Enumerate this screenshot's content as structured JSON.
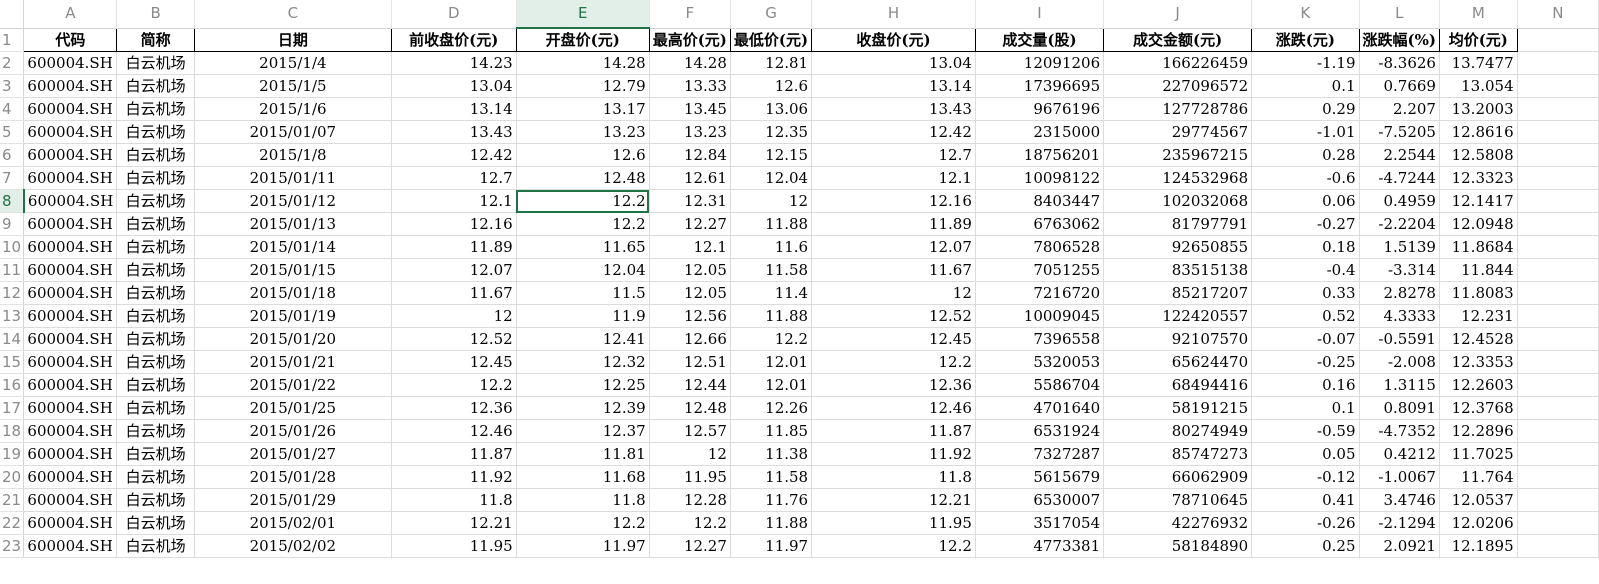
{
  "columns": [
    "A",
    "B",
    "C",
    "D",
    "E",
    "F",
    "G",
    "H",
    "I",
    "J",
    "K",
    "L",
    "M",
    "N"
  ],
  "headers": [
    "代码",
    "简称",
    "日期",
    "前收盘价(元)",
    "开盘价(元)",
    "最高价(元)",
    "最低价(元)",
    "收盘价(元)",
    "成交量(股)",
    "成交金额(元)",
    "涨跌(元)",
    "涨跌幅(%)",
    "均价(元)",
    ""
  ],
  "selected_column": "E",
  "selected_row": "8",
  "rows": [
    [
      "2",
      "600004.SH",
      "白云机场",
      "2015/1/4",
      "14.23",
      "14.28",
      "14.28",
      "12.81",
      "13.04",
      "12091206",
      "166226459",
      "-1.19",
      "-8.3626",
      "13.7477"
    ],
    [
      "3",
      "600004.SH",
      "白云机场",
      "2015/1/5",
      "13.04",
      "12.79",
      "13.33",
      "12.6",
      "13.14",
      "17396695",
      "227096572",
      "0.1",
      "0.7669",
      "13.054"
    ],
    [
      "4",
      "600004.SH",
      "白云机场",
      "2015/1/6",
      "13.14",
      "13.17",
      "13.45",
      "13.06",
      "13.43",
      "9676196",
      "127728786",
      "0.29",
      "2.207",
      "13.2003"
    ],
    [
      "5",
      "600004.SH",
      "白云机场",
      "2015/01/07",
      "13.43",
      "13.23",
      "13.23",
      "12.35",
      "12.42",
      "2315000",
      "29774567",
      "-1.01",
      "-7.5205",
      "12.8616"
    ],
    [
      "6",
      "600004.SH",
      "白云机场",
      "2015/1/8",
      "12.42",
      "12.6",
      "12.84",
      "12.15",
      "12.7",
      "18756201",
      "235967215",
      "0.28",
      "2.2544",
      "12.5808"
    ],
    [
      "7",
      "600004.SH",
      "白云机场",
      "2015/01/11",
      "12.7",
      "12.48",
      "12.61",
      "12.04",
      "12.1",
      "10098122",
      "124532968",
      "-0.6",
      "-4.7244",
      "12.3323"
    ],
    [
      "8",
      "600004.SH",
      "白云机场",
      "2015/01/12",
      "12.1",
      "12.2",
      "12.31",
      "12",
      "12.16",
      "8403447",
      "102032068",
      "0.06",
      "0.4959",
      "12.1417"
    ],
    [
      "9",
      "600004.SH",
      "白云机场",
      "2015/01/13",
      "12.16",
      "12.2",
      "12.27",
      "11.88",
      "11.89",
      "6763062",
      "81797791",
      "-0.27",
      "-2.2204",
      "12.0948"
    ],
    [
      "10",
      "600004.SH",
      "白云机场",
      "2015/01/14",
      "11.89",
      "11.65",
      "12.1",
      "11.6",
      "12.07",
      "7806528",
      "92650855",
      "0.18",
      "1.5139",
      "11.8684"
    ],
    [
      "11",
      "600004.SH",
      "白云机场",
      "2015/01/15",
      "12.07",
      "12.04",
      "12.05",
      "11.58",
      "11.67",
      "7051255",
      "83515138",
      "-0.4",
      "-3.314",
      "11.844"
    ],
    [
      "12",
      "600004.SH",
      "白云机场",
      "2015/01/18",
      "11.67",
      "11.5",
      "12.05",
      "11.4",
      "12",
      "7216720",
      "85217207",
      "0.33",
      "2.8278",
      "11.8083"
    ],
    [
      "13",
      "600004.SH",
      "白云机场",
      "2015/01/19",
      "12",
      "11.9",
      "12.56",
      "11.88",
      "12.52",
      "10009045",
      "122420557",
      "0.52",
      "4.3333",
      "12.231"
    ],
    [
      "14",
      "600004.SH",
      "白云机场",
      "2015/01/20",
      "12.52",
      "12.41",
      "12.66",
      "12.2",
      "12.45",
      "7396558",
      "92107570",
      "-0.07",
      "-0.5591",
      "12.4528"
    ],
    [
      "15",
      "600004.SH",
      "白云机场",
      "2015/01/21",
      "12.45",
      "12.32",
      "12.51",
      "12.01",
      "12.2",
      "5320053",
      "65624470",
      "-0.25",
      "-2.008",
      "12.3353"
    ],
    [
      "16",
      "600004.SH",
      "白云机场",
      "2015/01/22",
      "12.2",
      "12.25",
      "12.44",
      "12.01",
      "12.36",
      "5586704",
      "68494416",
      "0.16",
      "1.3115",
      "12.2603"
    ],
    [
      "17",
      "600004.SH",
      "白云机场",
      "2015/01/25",
      "12.36",
      "12.39",
      "12.48",
      "12.26",
      "12.46",
      "4701640",
      "58191215",
      "0.1",
      "0.8091",
      "12.3768"
    ],
    [
      "18",
      "600004.SH",
      "白云机场",
      "2015/01/26",
      "12.46",
      "12.37",
      "12.57",
      "11.85",
      "11.87",
      "6531924",
      "80274949",
      "-0.59",
      "-4.7352",
      "12.2896"
    ],
    [
      "19",
      "600004.SH",
      "白云机场",
      "2015/01/27",
      "11.87",
      "11.81",
      "12",
      "11.38",
      "11.92",
      "7327287",
      "85747273",
      "0.05",
      "0.4212",
      "11.7025"
    ],
    [
      "20",
      "600004.SH",
      "白云机场",
      "2015/01/28",
      "11.92",
      "11.68",
      "11.95",
      "11.58",
      "11.8",
      "5615679",
      "66062909",
      "-0.12",
      "-1.0067",
      "11.764"
    ],
    [
      "21",
      "600004.SH",
      "白云机场",
      "2015/01/29",
      "11.8",
      "11.8",
      "12.28",
      "11.76",
      "12.21",
      "6530007",
      "78710645",
      "0.41",
      "3.4746",
      "12.0537"
    ],
    [
      "22",
      "600004.SH",
      "白云机场",
      "2015/02/01",
      "12.21",
      "12.2",
      "12.2",
      "11.88",
      "11.95",
      "3517054",
      "42276932",
      "-0.26",
      "-2.1294",
      "12.0206"
    ],
    [
      "23",
      "600004.SH",
      "白云机场",
      "2015/02/02",
      "11.95",
      "11.97",
      "12.27",
      "11.97",
      "12.2",
      "4773381",
      "58184890",
      "0.25",
      "2.0921",
      "12.1895"
    ]
  ],
  "colors": {
    "accent": "#217346",
    "selected_header_bg": "#e2efe8",
    "gridline": "#dcdcdc"
  }
}
